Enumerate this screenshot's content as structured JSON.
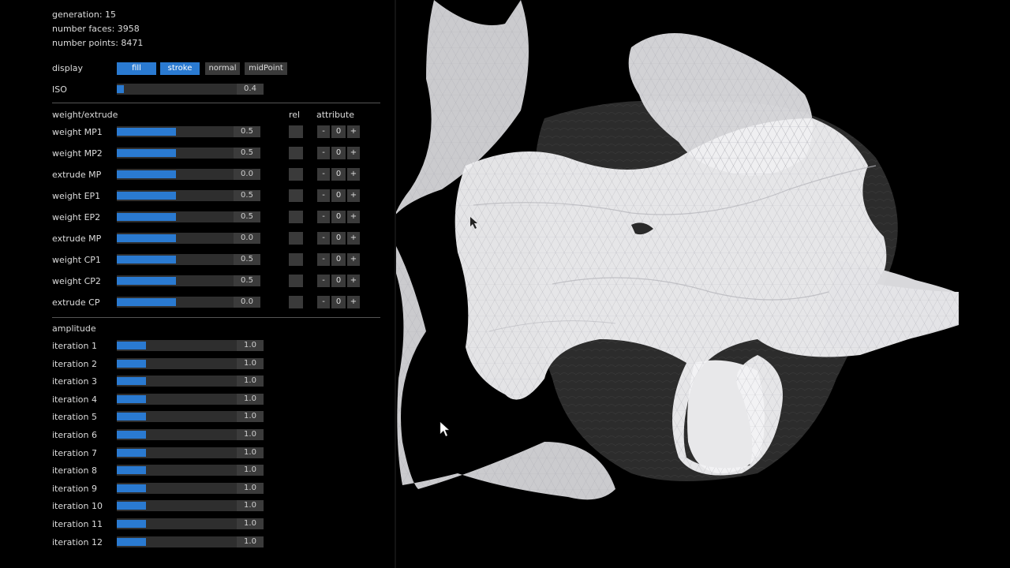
{
  "stats": {
    "generation_label": "generation",
    "generation_value": "15",
    "faces_label": "number faces",
    "faces_value": "3958",
    "points_label": "number points",
    "points_value": "8471"
  },
  "display": {
    "label": "display",
    "buttons": [
      {
        "label": "fill",
        "active": true
      },
      {
        "label": "stroke",
        "active": true
      },
      {
        "label": "normal",
        "active": false
      },
      {
        "label": "midPoint",
        "active": false
      }
    ]
  },
  "iso": {
    "label": "ISO",
    "value": "0.4",
    "fraction": 0.05
  },
  "weight_section": {
    "title": "weight/extrude",
    "rel_label": "rel",
    "attribute_label": "attribute",
    "rows": [
      {
        "label": "weight MP1",
        "value": "0.5",
        "fraction": 0.5,
        "attr": "0"
      },
      {
        "label": "weight MP2",
        "value": "0.5",
        "fraction": 0.5,
        "attr": "0"
      },
      {
        "label": "extrude MP",
        "value": "0.0",
        "fraction": 0.5,
        "attr": "0"
      },
      {
        "label": "weight EP1",
        "value": "0.5",
        "fraction": 0.5,
        "attr": "0"
      },
      {
        "label": "weight EP2",
        "value": "0.5",
        "fraction": 0.5,
        "attr": "0"
      },
      {
        "label": "extrude MP",
        "value": "0.0",
        "fraction": 0.5,
        "attr": "0"
      },
      {
        "label": "weight CP1",
        "value": "0.5",
        "fraction": 0.5,
        "attr": "0"
      },
      {
        "label": "weight CP2",
        "value": "0.5",
        "fraction": 0.5,
        "attr": "0"
      },
      {
        "label": "extrude CP",
        "value": "0.0",
        "fraction": 0.5,
        "attr": "0"
      }
    ],
    "minus": "-",
    "plus": "+"
  },
  "amplitude_section": {
    "title": "amplitude",
    "rows": [
      {
        "label": "iteration 1",
        "value": "1.0",
        "fraction": 0.2
      },
      {
        "label": "iteration 2",
        "value": "1.0",
        "fraction": 0.2
      },
      {
        "label": "iteration 3",
        "value": "1.0",
        "fraction": 0.2
      },
      {
        "label": "iteration 4",
        "value": "1.0",
        "fraction": 0.2
      },
      {
        "label": "iteration 5",
        "value": "1.0",
        "fraction": 0.2
      },
      {
        "label": "iteration 6",
        "value": "1.0",
        "fraction": 0.2
      },
      {
        "label": "iteration 7",
        "value": "1.0",
        "fraction": 0.2
      },
      {
        "label": "iteration 8",
        "value": "1.0",
        "fraction": 0.2
      },
      {
        "label": "iteration 9",
        "value": "1.0",
        "fraction": 0.2
      },
      {
        "label": "iteration 10",
        "value": "1.0",
        "fraction": 0.2
      },
      {
        "label": "iteration 11",
        "value": "1.0",
        "fraction": 0.2
      },
      {
        "label": "iteration 12",
        "value": "1.0",
        "fraction": 0.2
      }
    ]
  },
  "colors": {
    "accent": "#2a7ad1",
    "background": "#000000",
    "mesh_light": "#e8e8ec",
    "mesh_dark": "#2a2a2a"
  }
}
